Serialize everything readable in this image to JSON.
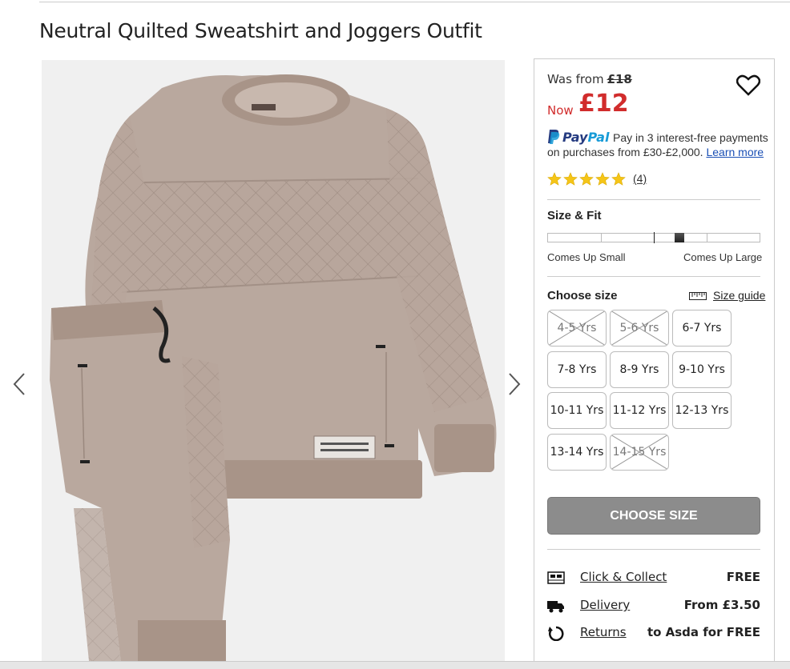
{
  "product": {
    "title": "Neutral Quilted Sweatshirt and Joggers Outfit",
    "image_alt": "Neutral quilted sweatshirt and joggers"
  },
  "price": {
    "was_label": "Was from",
    "was_value": "£18",
    "now_label": "Now",
    "now_value": "£12",
    "color": "#d12c2c"
  },
  "paypal": {
    "brand_part1": "Pay",
    "brand_part2": "Pal",
    "line1": "Pay in 3 interest-free payments",
    "line2": "on purchases from £30-£2,000.",
    "link": "Learn more"
  },
  "rating": {
    "stars": 5,
    "count": "(4)"
  },
  "fit": {
    "heading": "Size & Fit",
    "min_label": "Comes Up Small",
    "max_label": "Comes Up Large",
    "level": 0.62
  },
  "sizes": {
    "heading": "Choose size",
    "guide_label": "Size guide",
    "options": [
      {
        "label": "4-5 Yrs",
        "available": false
      },
      {
        "label": "5-6 Yrs",
        "available": false
      },
      {
        "label": "6-7 Yrs",
        "available": true
      },
      {
        "label": "7-8 Yrs",
        "available": true
      },
      {
        "label": "8-9 Yrs",
        "available": true
      },
      {
        "label": "9-10 Yrs",
        "available": true
      },
      {
        "label": "10-11 Yrs",
        "available": true
      },
      {
        "label": "11-12 Yrs",
        "available": true
      },
      {
        "label": "12-13 Yrs",
        "available": true
      },
      {
        "label": "13-14 Yrs",
        "available": true
      },
      {
        "label": "14-15 Yrs",
        "available": false
      }
    ]
  },
  "cta": {
    "label": "CHOOSE SIZE",
    "color": "#8c8c8c"
  },
  "delivery": [
    {
      "icon": "store-icon",
      "label": "Click & Collect",
      "value": "FREE"
    },
    {
      "icon": "truck-icon",
      "label": "Delivery",
      "value": "From £3.50"
    },
    {
      "icon": "return-icon",
      "label": "Returns",
      "value": "to Asda for FREE"
    }
  ]
}
